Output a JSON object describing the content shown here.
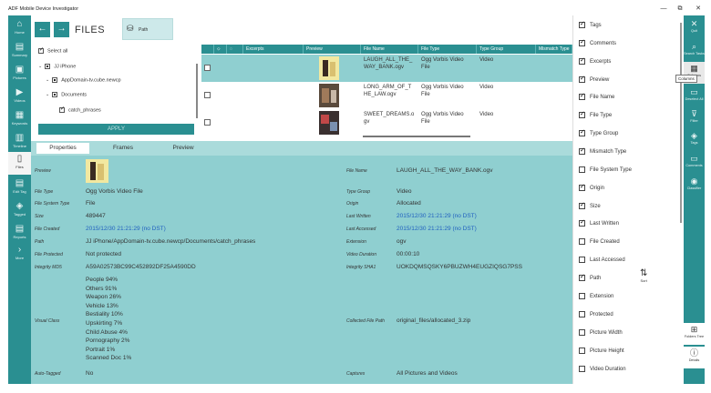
{
  "window": {
    "title": "ADF Mobile Device Investigator",
    "minimize": "—",
    "restore": "⧉",
    "close": "✕"
  },
  "left_nav": [
    {
      "label": "Home",
      "icon": "home-icon",
      "glyph": "⌂"
    },
    {
      "label": "Summary",
      "icon": "summary-icon",
      "glyph": "▤"
    },
    {
      "label": "Pictures",
      "icon": "pictures-icon",
      "glyph": "▣"
    },
    {
      "label": "Videos",
      "icon": "videos-icon",
      "glyph": "▶"
    },
    {
      "label": "Keywords",
      "icon": "keywords-icon",
      "glyph": "▦"
    },
    {
      "label": "Timeline",
      "icon": "timeline-icon",
      "glyph": "▥"
    },
    {
      "label": "Files",
      "icon": "files-icon",
      "glyph": "▯"
    },
    {
      "label": "Edit Tag",
      "icon": "edit-tag-icon",
      "glyph": "▤"
    },
    {
      "label": "Tagged",
      "icon": "tagged-icon",
      "glyph": "◈"
    },
    {
      "label": "Reports",
      "icon": "reports-icon",
      "glyph": "▤"
    },
    {
      "label": "More",
      "icon": "more-icon",
      "glyph": "›"
    }
  ],
  "files": {
    "back": "←",
    "forward": "→",
    "title": "FILES",
    "path_button": "Path"
  },
  "tree": {
    "select_all": "Select all",
    "nodes": [
      "JJ iPhone",
      "AppDomain-tv.cube.newcp",
      "Documents",
      "catch_phrases"
    ],
    "apply": "APPLY"
  },
  "grid": {
    "columns": [
      "",
      "",
      "Excerpts",
      "Preview",
      "File Name",
      "File Type",
      "Type Group",
      "Mismatch Type"
    ],
    "rows": [
      {
        "file_name": "LAUGH_ALL_THE_WAY_BANK.ogv",
        "file_name_l1": "LAUGH_ALL_THE_",
        "file_name_l2": "WAY_BANK.ogv",
        "file_type_l1": "Ogg Vorbis Video",
        "file_type_l2": "File",
        "type_group": "Video"
      },
      {
        "file_name": "LONG_ARM_OF_THE_LAW.ogv",
        "file_name_l1": "LONG_ARM_OF_T",
        "file_name_l2": "HE_LAW.ogv",
        "file_type_l1": "Ogg Vorbis Video",
        "file_type_l2": "File",
        "type_group": "Video"
      },
      {
        "file_name": "SWEET_DREAMS.ogv",
        "file_name_l1": "SWEET_DREAMS.o",
        "file_name_l2": "gv",
        "file_type_l1": "Ogg Vorbis Video",
        "file_type_l2": "File",
        "type_group": "Video"
      }
    ]
  },
  "details": {
    "tabs": [
      "Properties",
      "Frames",
      "Preview"
    ],
    "left": {
      "preview_label": "Preview",
      "file_type_label": "File Type",
      "file_type": "Ogg Vorbis Video File",
      "fs_type_label": "File System Type",
      "fs_type": "File",
      "size_label": "Size",
      "size": "489447",
      "created_label": "File Created",
      "created": "2015/12/30 21:21:29 (no DST)",
      "path_label": "Path",
      "path": "JJ iPhone/AppDomain-tv.cube.newcp/Documents/catch_phrases",
      "protected_label": "File Protected",
      "protected": "Not protected",
      "md5_label": "Integrity MD5",
      "md5": "A59A02573BC99C452892DF25A4590DD",
      "visual_label": "Visual Class",
      "visual": [
        "People 94%",
        "Others 91%",
        "Weapon 26%",
        "Vehicle 13%",
        "Bestiality 10%",
        "Upskirting 7%",
        "Child Abuse 4%",
        "Pornography 2%",
        "Portrait 1%",
        "Scanned Doc 1%"
      ],
      "autotag_label": "Auto-Tagged",
      "autotag": "No"
    },
    "right": {
      "file_name_label": "File Name",
      "file_name": "LAUGH_ALL_THE_WAY_BANK.ogv",
      "type_group_label": "Type Group",
      "type_group": "Video",
      "origin_label": "Origin",
      "origin": "Allocated",
      "written_label": "Last Written",
      "written": "2015/12/30 21:21:29 (no DST)",
      "accessed_label": "Last Accessed",
      "accessed": "2015/12/30 21:21:29 (no DST)",
      "ext_label": "Extension",
      "ext": "ogv",
      "duration_label": "Video Duration",
      "duration": "00:00:10",
      "sha_label": "Integrity SHA1",
      "sha": "UOKDQMSQSKY6PBUZWH4EUGZIQSG7PSS",
      "collected_label": "Collected File Path",
      "collected": "original_files/allocated_3.zip",
      "captures_label": "Captures",
      "captures": "All Pictures and Videos"
    }
  },
  "columns_panel": {
    "items": [
      {
        "label": "Tags",
        "checked": true
      },
      {
        "label": "Comments",
        "checked": true
      },
      {
        "label": "Excerpts",
        "checked": true
      },
      {
        "label": "Preview",
        "checked": true
      },
      {
        "label": "File Name",
        "checked": true
      },
      {
        "label": "File Type",
        "checked": true
      },
      {
        "label": "Type Group",
        "checked": true
      },
      {
        "label": "Mismatch Type",
        "checked": true
      },
      {
        "label": "File System Type",
        "checked": false
      },
      {
        "label": "Origin",
        "checked": true
      },
      {
        "label": "Size",
        "checked": true
      },
      {
        "label": "Last Written",
        "checked": true
      },
      {
        "label": "File Created",
        "checked": false
      },
      {
        "label": "Last Accessed",
        "checked": false
      },
      {
        "label": "Path",
        "checked": true
      },
      {
        "label": "Extension",
        "checked": false
      },
      {
        "label": "Protected",
        "checked": false
      },
      {
        "label": "Picture Width",
        "checked": false
      },
      {
        "label": "Picture Height",
        "checked": false
      },
      {
        "label": "Video Duration",
        "checked": false
      }
    ],
    "sort_label": "Sort"
  },
  "right_nav": [
    {
      "label": "Quit",
      "icon": "quit-icon",
      "glyph": "✕"
    },
    {
      "label": "Search Tasks",
      "icon": "search-icon",
      "glyph": "⌕"
    },
    {
      "label": "Columns",
      "icon": "columns-icon",
      "glyph": "▦"
    },
    {
      "label": "Deselect All",
      "icon": "deselect-icon",
      "glyph": "▭"
    },
    {
      "label": "Filter",
      "icon": "filter-icon",
      "glyph": "⊽"
    },
    {
      "label": "Tags",
      "icon": "tags-icon",
      "glyph": "◈"
    },
    {
      "label": "Comments",
      "icon": "comments-icon",
      "glyph": "▭"
    },
    {
      "label": "Classifier",
      "icon": "classifier-icon",
      "glyph": "◉"
    },
    {
      "label": "Folders Tree",
      "icon": "folders-icon",
      "glyph": "⊞"
    },
    {
      "label": "Details",
      "icon": "details-icon",
      "glyph": "ⓘ"
    }
  ],
  "tooltip": "Columns"
}
